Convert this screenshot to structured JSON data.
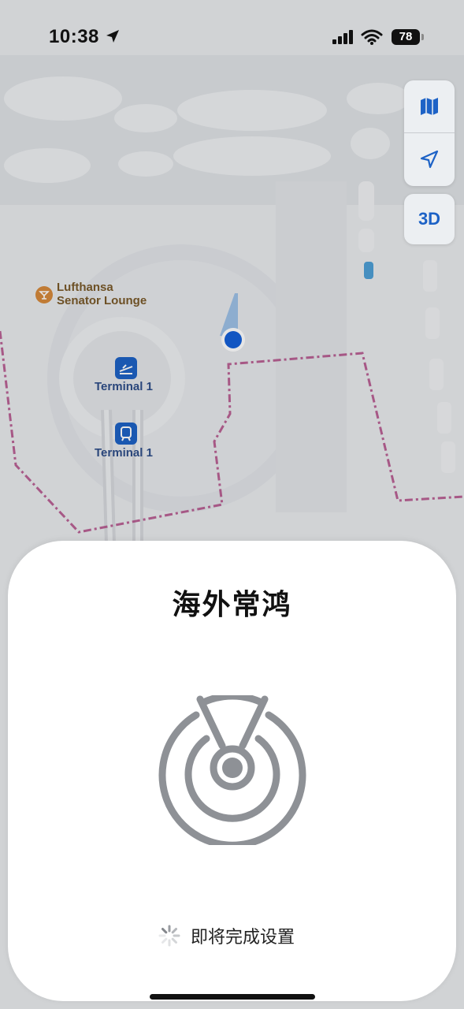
{
  "status_bar": {
    "time": "10:38",
    "battery": "78"
  },
  "map": {
    "pois": [
      {
        "label": "Terminal 1",
        "icon": "departures-icon"
      },
      {
        "label": "Terminal 1",
        "icon": "train-icon"
      }
    ],
    "lounge": {
      "line1": "Lufthansa",
      "line2": "Senator Lounge",
      "icon": "cocktail-icon"
    },
    "controls": {
      "map_mode_icon": "map-icon",
      "locate_icon": "location-arrow-icon",
      "three_d_label": "3D"
    },
    "colors": {
      "accent": "#1d62c6",
      "route": "#b24a86",
      "user_dot": "#1560d8"
    }
  },
  "sheet": {
    "title": "海外常鸿",
    "status_text": "即将完成设置",
    "icon": "findmy-radar-icon",
    "icon_color": "#8e9196"
  }
}
